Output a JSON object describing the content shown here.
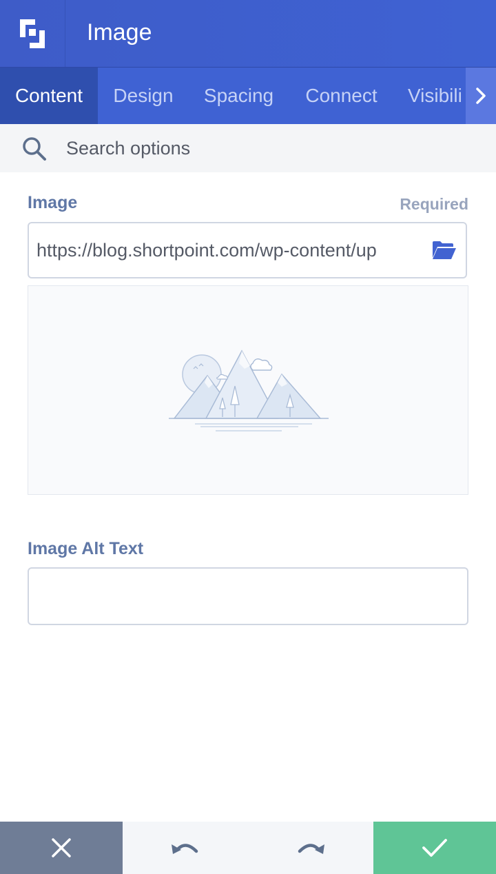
{
  "header": {
    "title": "Image"
  },
  "tabs": [
    {
      "label": "Content",
      "active": true
    },
    {
      "label": "Design",
      "active": false
    },
    {
      "label": "Spacing",
      "active": false
    },
    {
      "label": "Connect",
      "active": false
    },
    {
      "label": "Visibili",
      "active": false
    }
  ],
  "search": {
    "placeholder": "Search options",
    "value": ""
  },
  "image_field": {
    "label": "Image",
    "required_text": "Required",
    "value": "https://blog.shortpoint.com/wp-content/up"
  },
  "alt_field": {
    "label": "Image Alt Text",
    "value": ""
  },
  "icons": {
    "logo": "shortpoint-logo-icon",
    "tab_scroll": "chevron-right-icon",
    "search": "search-icon",
    "browse": "folder-open-icon",
    "placeholder": "mountain-landscape-icon",
    "cancel": "close-icon",
    "undo": "undo-icon",
    "redo": "redo-icon",
    "confirm": "check-icon"
  },
  "colors": {
    "header": "#3e5cc8",
    "tab_active": "#2f4fae",
    "cancel": "#6f7d96",
    "confirm": "#5fc596",
    "label": "#5f77a6"
  }
}
